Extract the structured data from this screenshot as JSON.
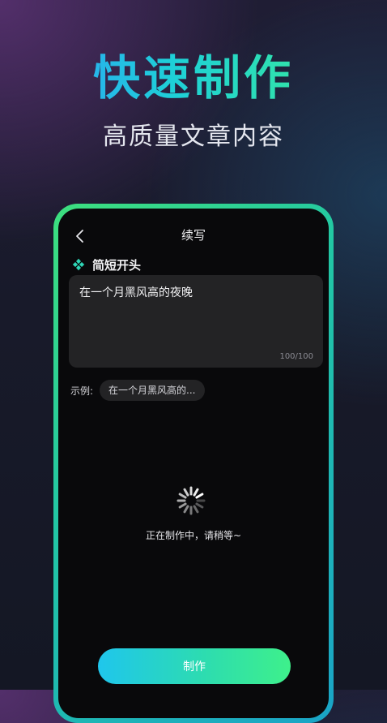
{
  "hero": {
    "title": "快速制作",
    "subtitle": "高质量文章内容"
  },
  "app": {
    "nav": {
      "back_icon": "chevron-left-icon",
      "title": "续写"
    },
    "section": {
      "icon": "sparkle-diamond-icon",
      "label": "简短开头"
    },
    "input": {
      "value": "在一个月黑风高的夜晚",
      "counter": "100/100"
    },
    "example": {
      "label": "示例:",
      "chip": "在一个月黑风高的..."
    },
    "loading": {
      "icon": "loading-spinner-icon",
      "text": "正在制作中，请稍等~"
    },
    "action": {
      "label": "制作"
    }
  },
  "colors": {
    "brand_gradient_start": "#2f97ff",
    "brand_gradient_end": "#3ef08b",
    "phone_frame": "#22c7a4",
    "screen_background": "#09090b",
    "input_background": "#232325"
  }
}
